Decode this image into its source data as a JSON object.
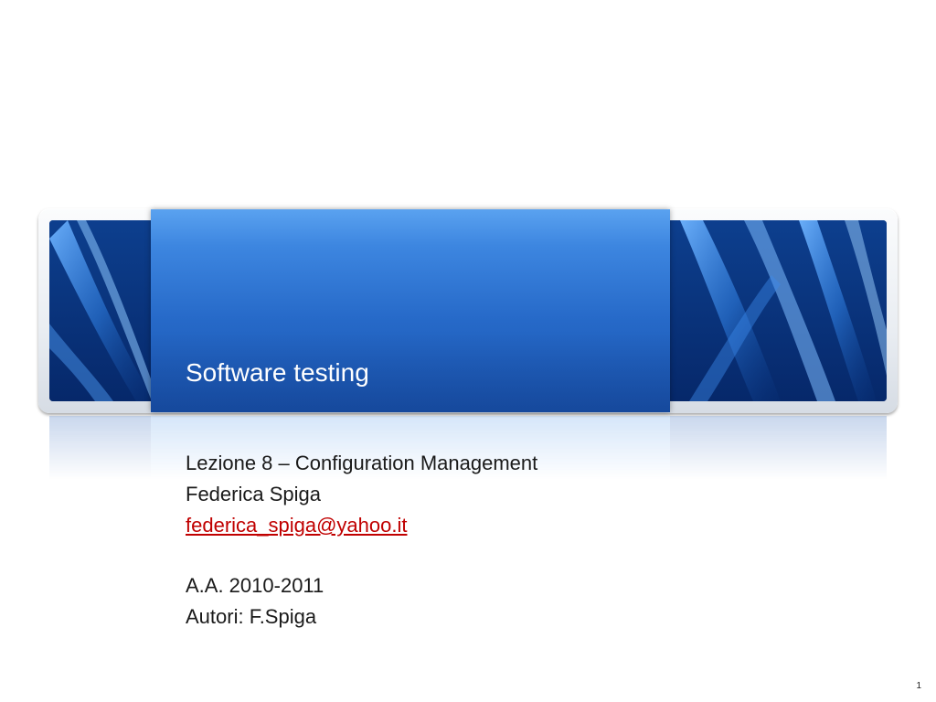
{
  "slide": {
    "title": "Software testing",
    "subtitle": {
      "lecture": "Lezione 8 – Configuration Management",
      "author": "Federica Spiga",
      "email": "federica_spiga@yahoo.it",
      "year": "A.A. 2010-2011",
      "authors": "Autori: F.Spiga"
    },
    "page_number": "1"
  },
  "colors": {
    "banner_dark": "#0b3b86",
    "panel_blue": "#2669c8",
    "link_red": "#c00000"
  }
}
